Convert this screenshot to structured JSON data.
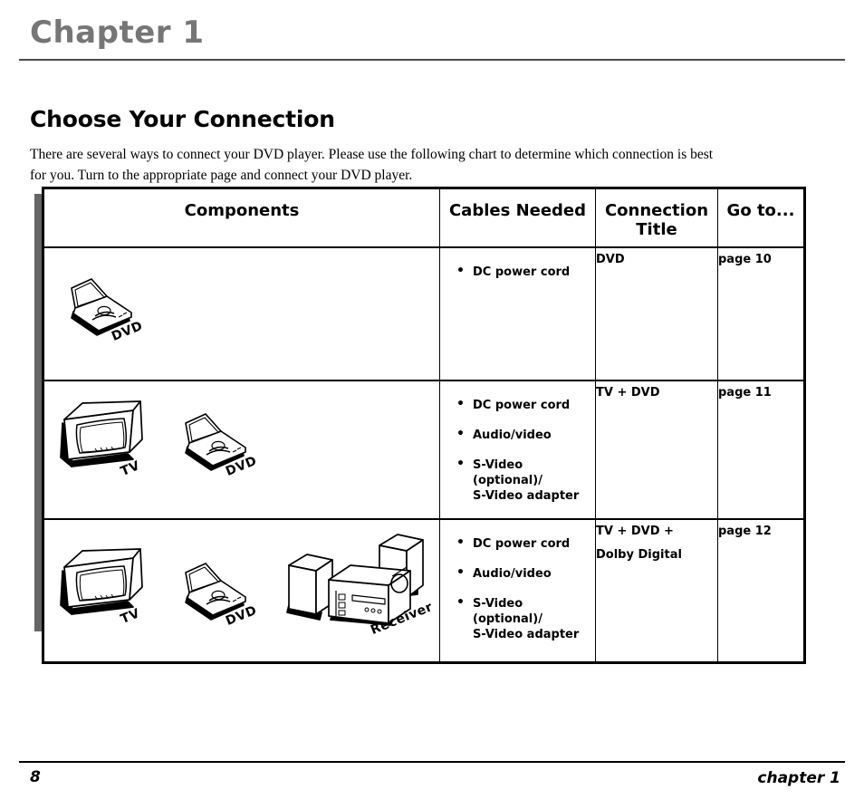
{
  "header": {
    "chapter_title": "Chapter 1"
  },
  "section": {
    "title": "Choose Your Connection",
    "intro": "There are several ways to connect your DVD player. Please use the following chart to determine which connection is best for you. Turn to the appropriate page and connect your DVD player."
  },
  "table": {
    "columns": [
      {
        "id": "components",
        "label": "Components"
      },
      {
        "id": "cables",
        "label": "Cables Needed"
      },
      {
        "id": "title",
        "label": "Connection Title"
      },
      {
        "id": "goto",
        "label": "Go to..."
      }
    ],
    "rows": [
      {
        "devices": [
          {
            "icon": "dvd-player-icon",
            "label": "DVD"
          }
        ],
        "cables": [
          {
            "line1": "DC power cord",
            "line2": ""
          }
        ],
        "connection_title": [
          "DVD"
        ],
        "goto": "page 10"
      },
      {
        "devices": [
          {
            "icon": "tv-icon",
            "label": "TV"
          },
          {
            "icon": "dvd-player-icon",
            "label": "DVD"
          }
        ],
        "cables": [
          {
            "line1": "DC power cord",
            "line2": ""
          },
          {
            "line1": "Audio/video",
            "line2": ""
          },
          {
            "line1": "S-Video (optional)/",
            "line2": "S-Video adapter"
          }
        ],
        "connection_title": [
          "TV + DVD"
        ],
        "goto": "page 11"
      },
      {
        "devices": [
          {
            "icon": "tv-icon",
            "label": "TV"
          },
          {
            "icon": "dvd-player-icon",
            "label": "DVD"
          },
          {
            "icon": "receiver-icon",
            "label": "Receiver"
          }
        ],
        "cables": [
          {
            "line1": "DC power cord",
            "line2": ""
          },
          {
            "line1": "Audio/video",
            "line2": ""
          },
          {
            "line1": "S-Video (optional)/",
            "line2": "S-Video adapter"
          }
        ],
        "connection_title": [
          "TV + DVD +",
          "Dolby Digital"
        ],
        "goto": "page 12"
      }
    ]
  },
  "footer": {
    "page_number": "8",
    "chapter_label": "chapter 1"
  },
  "colors": {
    "chapter_gray": "#767676",
    "table_shadow": "#666666",
    "rule": "#4a4a4a",
    "ink": "#000000",
    "paper": "#ffffff"
  }
}
